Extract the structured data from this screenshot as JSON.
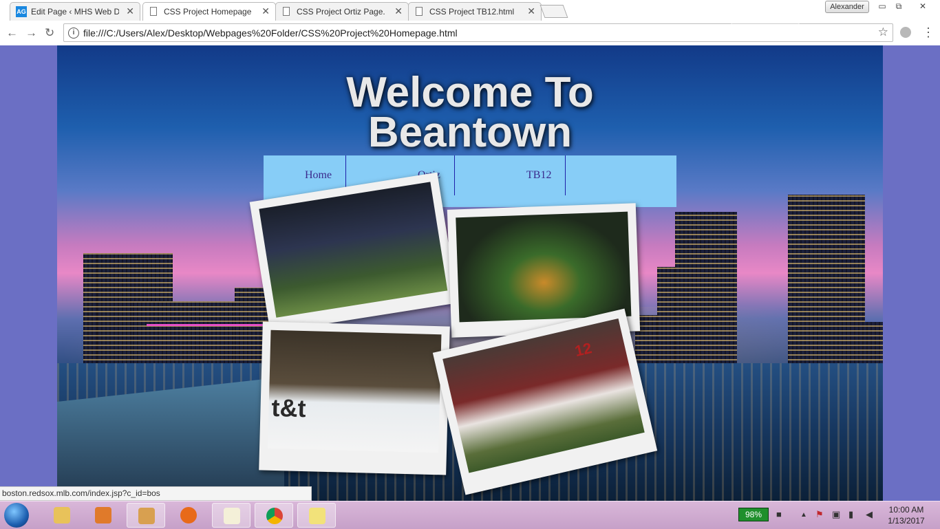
{
  "browser": {
    "tabs": [
      {
        "title": "Edit Page ‹ MHS Web De",
        "favicon": "AG",
        "active": false
      },
      {
        "title": "CSS Project Homepage.h",
        "favicon": "document-icon",
        "active": true
      },
      {
        "title": "CSS Project Ortiz Page.ht",
        "favicon": "document-icon",
        "active": false
      },
      {
        "title": "CSS Project TB12.html",
        "favicon": "document-icon",
        "active": false
      }
    ],
    "profile_name": "Alexander",
    "url": "file:///C:/Users/Alex/Desktop/Webpages%20Folder/CSS%20Project%20Homepage.html",
    "tab_close_glyph": "✕",
    "back_glyph": "←",
    "forward_glyph": "→",
    "reload_glyph": "↻",
    "star_glyph": "☆",
    "menu_glyph": "⋮",
    "window_minimize": "▭",
    "window_restore": "⧉",
    "window_close": "✕"
  },
  "page": {
    "title_line1": "Welcome To",
    "title_line2": "Beantown",
    "nav": [
      {
        "label": "Home"
      },
      {
        "label": "Ortiz"
      },
      {
        "label": "TB12"
      }
    ],
    "photos": [
      {
        "name": "patriots-photo"
      },
      {
        "name": "celtics-photo"
      },
      {
        "name": "bruins-photo"
      },
      {
        "name": "redsox-photo"
      }
    ],
    "bruins_boards_text": "t&t",
    "redsox_jersey_number": "12",
    "colors": {
      "background": "#6b6fc4",
      "nav_bg": "#87cdf7",
      "nav_text": "#3b2a8c",
      "nav_divider": "#1d1da8"
    }
  },
  "status_url": "boston.redsox.mlb.com/index.jsp?c_id=bos",
  "taskbar": {
    "battery": "98%",
    "time": "10:00 AM",
    "date": "1/13/2017",
    "apps": [
      "file-explorer-icon",
      "media-player-icon",
      "paint-icon",
      "firefox-icon",
      "notepad-icon",
      "chrome-icon",
      "sticky-notes-icon"
    ]
  }
}
